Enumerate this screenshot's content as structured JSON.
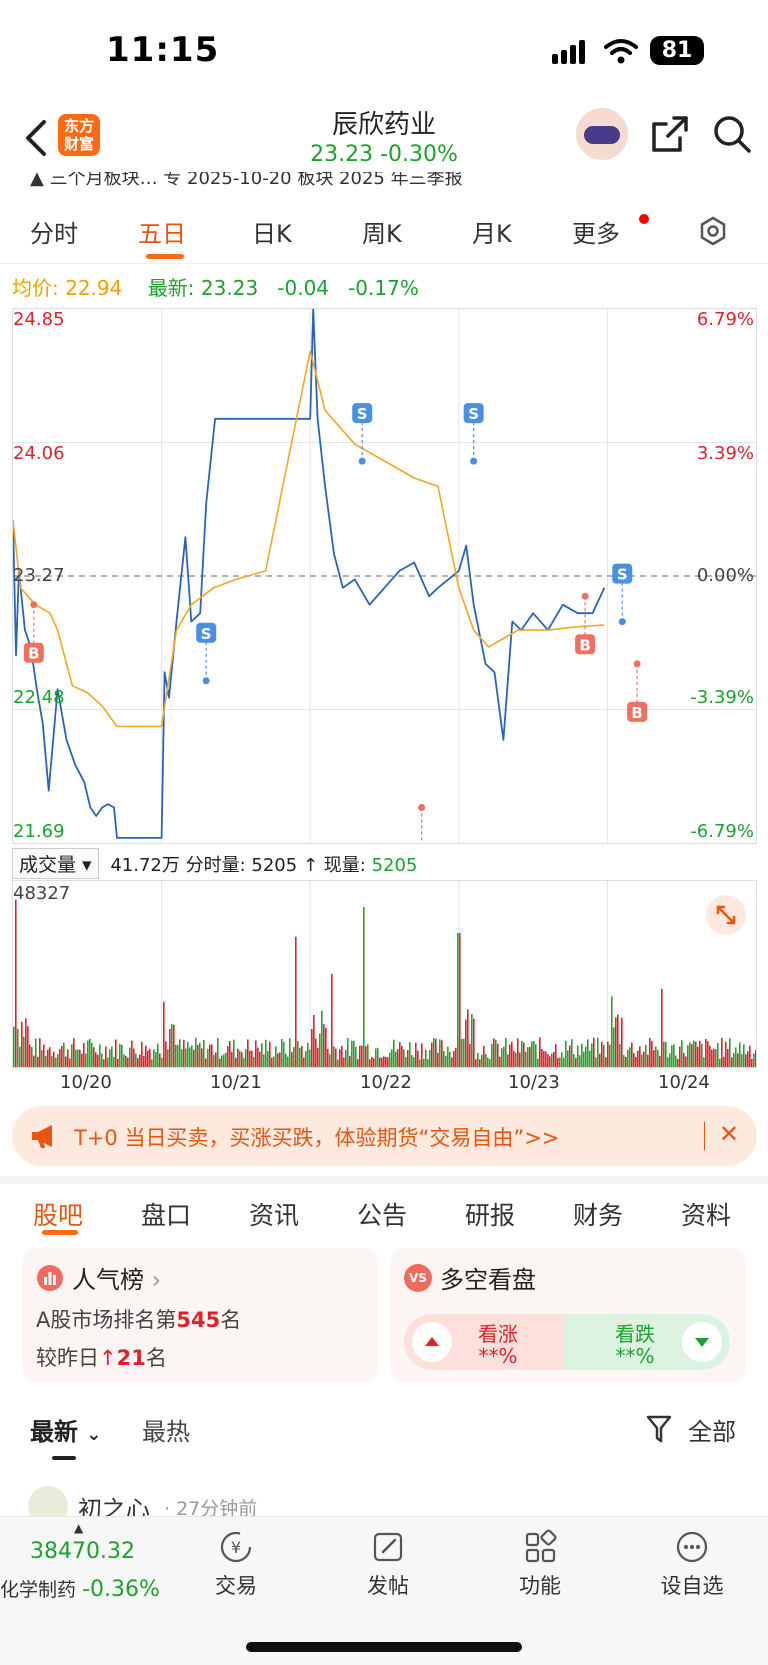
{
  "status_bar": {
    "time": "11:15",
    "battery": "81"
  },
  "nav": {
    "logo_line1": "东方",
    "logo_line2": "财富",
    "title": "辰欣药业",
    "price": "23.23",
    "change_pct": "-0.30%"
  },
  "ticker_strip": "▲ 三个月板块… 专 2025-10-20 板块 2025 年三季报",
  "tabs": [
    "分时",
    "五日",
    "日K",
    "周K",
    "月K",
    "更多"
  ],
  "active_tab": "五日",
  "info": {
    "avg_label": "均价:",
    "avg_value": "22.94",
    "latest_label": "最新:",
    "latest_value": "23.23",
    "change": "-0.04",
    "change_pct": "-0.17%"
  },
  "chart_data": {
    "type": "line",
    "x_labels": [
      "10/20",
      "10/21",
      "10/22",
      "10/23",
      "10/24"
    ],
    "y_left_ticks": [
      "24.85",
      "24.06",
      "23.27",
      "22.48",
      "21.69"
    ],
    "y_right_ticks": [
      "6.79%",
      "3.39%",
      "0.00%",
      "-3.39%",
      "-6.79%"
    ],
    "ylim": [
      21.69,
      24.85
    ],
    "reference_price": 23.27,
    "series": [
      {
        "name": "最新",
        "color": "#2a64b8",
        "points": [
          [
            0.0,
            23.6
          ],
          [
            0.02,
            22.8
          ],
          [
            0.04,
            23.3
          ],
          [
            0.08,
            22.95
          ],
          [
            0.12,
            22.85
          ],
          [
            0.16,
            22.6
          ],
          [
            0.2,
            22.4
          ],
          [
            0.24,
            22.0
          ],
          [
            0.3,
            22.6
          ],
          [
            0.36,
            22.3
          ],
          [
            0.42,
            22.15
          ],
          [
            0.48,
            22.05
          ],
          [
            0.52,
            21.9
          ],
          [
            0.56,
            21.85
          ],
          [
            0.6,
            21.9
          ],
          [
            0.64,
            21.92
          ],
          [
            0.68,
            21.9
          ],
          [
            0.7,
            21.72
          ],
          [
            1.0,
            21.72
          ],
          [
            1.02,
            22.7
          ],
          [
            1.05,
            22.55
          ],
          [
            1.1,
            23.0
          ],
          [
            1.16,
            23.5
          ],
          [
            1.2,
            23.0
          ],
          [
            1.26,
            23.05
          ],
          [
            1.3,
            23.7
          ],
          [
            1.36,
            24.2
          ],
          [
            1.5,
            24.2
          ],
          [
            1.6,
            24.2
          ],
          [
            1.7,
            24.2
          ],
          [
            2.0,
            24.2
          ],
          [
            2.02,
            24.85
          ],
          [
            2.05,
            24.2
          ],
          [
            2.1,
            23.8
          ],
          [
            2.16,
            23.4
          ],
          [
            2.22,
            23.2
          ],
          [
            2.3,
            23.25
          ],
          [
            2.4,
            23.1
          ],
          [
            2.5,
            23.2
          ],
          [
            2.6,
            23.3
          ],
          [
            2.7,
            23.35
          ],
          [
            2.8,
            23.15
          ],
          [
            2.86,
            23.2
          ],
          [
            3.0,
            23.3
          ],
          [
            3.05,
            23.45
          ],
          [
            3.1,
            23.1
          ],
          [
            3.18,
            22.75
          ],
          [
            3.24,
            22.7
          ],
          [
            3.3,
            22.3
          ],
          [
            3.36,
            23.0
          ],
          [
            3.42,
            22.95
          ],
          [
            3.5,
            23.05
          ],
          [
            3.6,
            22.95
          ],
          [
            3.7,
            23.1
          ],
          [
            3.8,
            23.05
          ],
          [
            3.9,
            23.05
          ],
          [
            3.98,
            23.2
          ]
        ]
      },
      {
        "name": "均价",
        "color": "#f5a623",
        "points": [
          [
            0.0,
            23.6
          ],
          [
            0.05,
            23.2
          ],
          [
            0.15,
            23.1
          ],
          [
            0.25,
            23.05
          ],
          [
            0.3,
            22.95
          ],
          [
            0.4,
            22.62
          ],
          [
            0.5,
            22.58
          ],
          [
            0.6,
            22.5
          ],
          [
            0.7,
            22.38
          ],
          [
            1.0,
            22.38
          ],
          [
            1.1,
            22.95
          ],
          [
            1.2,
            23.1
          ],
          [
            1.35,
            23.2
          ],
          [
            1.5,
            23.25
          ],
          [
            1.7,
            23.3
          ],
          [
            2.0,
            24.6
          ],
          [
            2.1,
            24.25
          ],
          [
            2.2,
            24.15
          ],
          [
            2.3,
            24.05
          ],
          [
            2.4,
            24.0
          ],
          [
            2.5,
            23.95
          ],
          [
            2.6,
            23.9
          ],
          [
            2.7,
            23.85
          ],
          [
            2.86,
            23.8
          ],
          [
            3.0,
            23.2
          ],
          [
            3.1,
            22.95
          ],
          [
            3.2,
            22.85
          ],
          [
            3.3,
            22.9
          ],
          [
            3.4,
            22.95
          ],
          [
            3.6,
            22.95
          ],
          [
            3.8,
            22.97
          ],
          [
            3.98,
            22.98
          ]
        ]
      }
    ],
    "markers": [
      {
        "type": "B",
        "x": 0.14,
        "price": 23.1
      },
      {
        "type": "S",
        "x": 1.3,
        "price": 22.65
      },
      {
        "type": "B",
        "x": 2.75,
        "price": 21.9
      },
      {
        "type": "S",
        "x": 2.35,
        "price": 23.95
      },
      {
        "type": "S",
        "x": 3.1,
        "price": 23.95
      },
      {
        "type": "B",
        "x": 3.85,
        "price": 23.15
      },
      {
        "type": "S",
        "x": 4.1,
        "price": 23.0
      },
      {
        "type": "B",
        "x": 4.2,
        "price": 22.75
      }
    ]
  },
  "volume": {
    "selector": "成交量",
    "total": "41.72万",
    "tick_label": "分时量:",
    "tick_value": "5205",
    "arrow": "↑",
    "now_label": "现量:",
    "now_value": "5205",
    "max": "48327"
  },
  "banner": {
    "text": "T+0 当日买卖，买涨买跌，体验期货“交易自由”>>",
    "close": "✕"
  },
  "section_tabs": [
    "股吧",
    "盘口",
    "资讯",
    "公告",
    "研报",
    "财务",
    "资料"
  ],
  "active_section": "股吧",
  "popularity": {
    "title": "人气榜",
    "rank_prefix": "A股市场排名第",
    "rank": "545",
    "rank_suffix": "名",
    "change_prefix": "较昨日",
    "change_arrow": "↑",
    "change": "21",
    "change_suffix": "名"
  },
  "sentiment": {
    "title": "多空看盘",
    "bull_label": "看涨",
    "bull_value": "**%",
    "bear_label": "看跌",
    "bear_value": "**%"
  },
  "filters": {
    "latest": "最新",
    "hot": "最热",
    "all": "全部"
  },
  "post_preview": {
    "author": "初之心",
    "time": "· 27分钟前"
  },
  "bottom_bar": {
    "index_value": "38470.32",
    "index_name": "化学制药",
    "index_change": "-0.36%",
    "items": [
      "交易",
      "发帖",
      "功能",
      "设自选"
    ]
  }
}
